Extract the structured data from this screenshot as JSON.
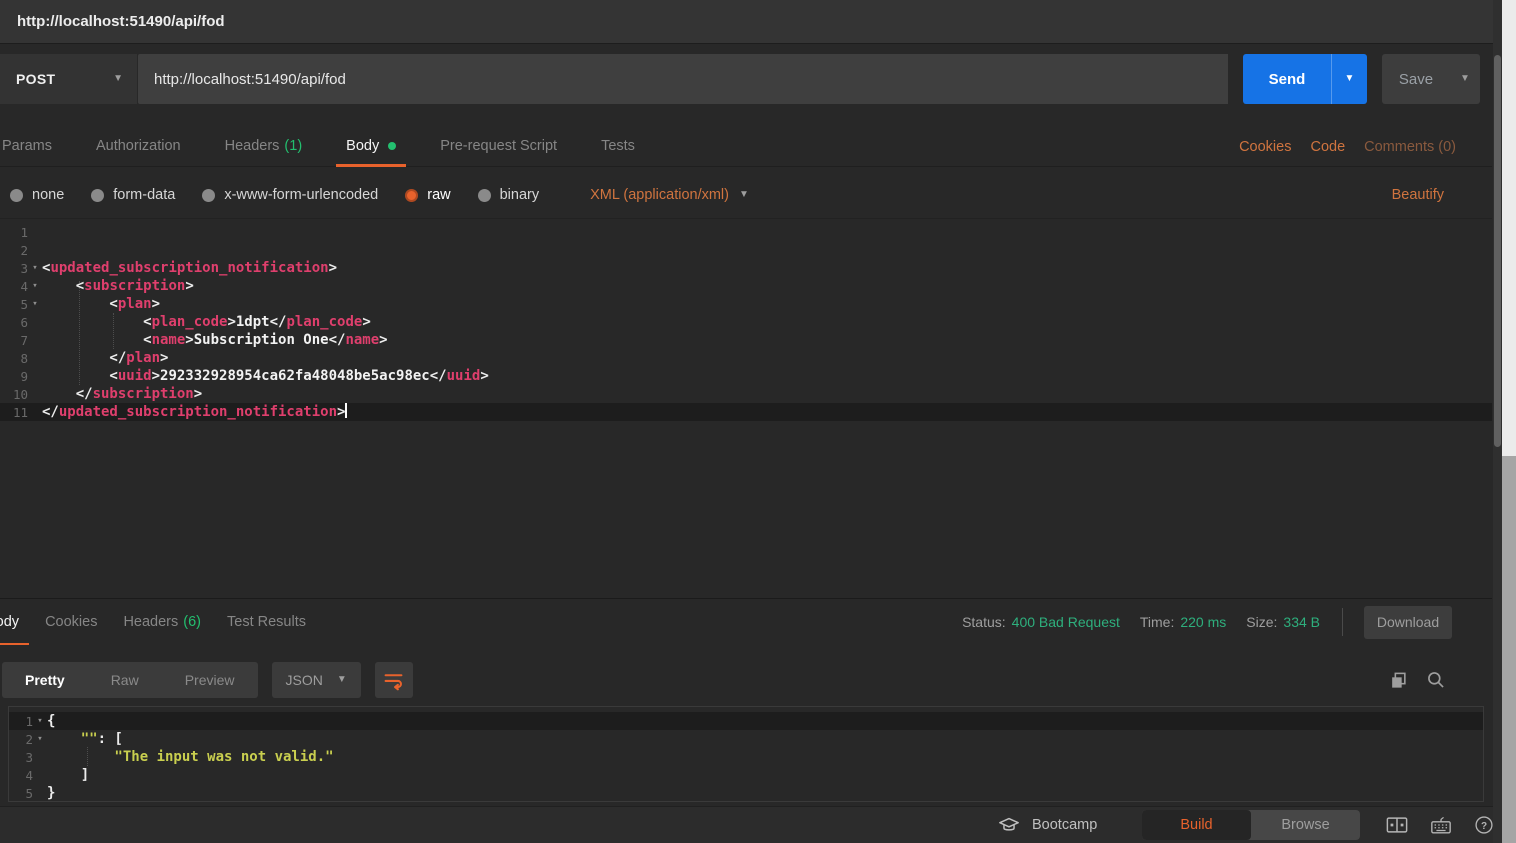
{
  "colors": {
    "accent_orange": "#e8622c",
    "link_orange": "#d0743f",
    "green": "#23bf6f",
    "status_green": "#2eaf7d",
    "blue": "#1673e6",
    "code_pink": "#df3f6d",
    "code_yellow": "#c9cf4f"
  },
  "titlebar": {
    "title": "http://localhost:51490/api/fod"
  },
  "request_bar": {
    "method": "POST",
    "url": "http://localhost:51490/api/fod",
    "send_label": "Send",
    "save_label": "Save"
  },
  "request_tabs": {
    "items": [
      {
        "label": "Params"
      },
      {
        "label": "Authorization"
      },
      {
        "label": "Headers",
        "count": "(1)"
      },
      {
        "label": "Body",
        "active": true,
        "dot": true
      },
      {
        "label": "Pre-request Script"
      },
      {
        "label": "Tests"
      }
    ],
    "links": [
      {
        "label": "Cookies"
      },
      {
        "label": "Code"
      },
      {
        "label": "Comments (0)",
        "muted": true
      }
    ]
  },
  "body_type_row": {
    "options": [
      {
        "label": "none"
      },
      {
        "label": "form-data"
      },
      {
        "label": "x-www-form-urlencoded"
      },
      {
        "label": "raw",
        "selected": true
      },
      {
        "label": "binary"
      }
    ],
    "content_type": "XML (application/xml)",
    "beautify_label": "Beautify"
  },
  "request_editor": {
    "lines": [
      {
        "n": 1,
        "segs": []
      },
      {
        "n": 2,
        "segs": []
      },
      {
        "n": 3,
        "fold": true,
        "segs": [
          [
            "p",
            "<"
          ],
          [
            "t",
            "updated_subscription_notification"
          ],
          [
            "p",
            ">"
          ]
        ]
      },
      {
        "n": 4,
        "fold": true,
        "segs": [
          [
            "p",
            "    <"
          ],
          [
            "t",
            "subscription"
          ],
          [
            "p",
            ">"
          ]
        ]
      },
      {
        "n": 5,
        "fold": true,
        "segs": [
          [
            "p",
            "        <"
          ],
          [
            "t",
            "plan"
          ],
          [
            "p",
            ">"
          ]
        ]
      },
      {
        "n": 6,
        "segs": [
          [
            "p",
            "            <"
          ],
          [
            "t",
            "plan_code"
          ],
          [
            "p",
            ">"
          ],
          [
            "v",
            "1dpt"
          ],
          [
            "p",
            "</"
          ],
          [
            "t",
            "plan_code"
          ],
          [
            "p",
            ">"
          ]
        ]
      },
      {
        "n": 7,
        "segs": [
          [
            "p",
            "            <"
          ],
          [
            "t",
            "name"
          ],
          [
            "p",
            ">"
          ],
          [
            "v",
            "Subscription One"
          ],
          [
            "p",
            "</"
          ],
          [
            "t",
            "name"
          ],
          [
            "p",
            ">"
          ]
        ]
      },
      {
        "n": 8,
        "segs": [
          [
            "p",
            "        </"
          ],
          [
            "t",
            "plan"
          ],
          [
            "p",
            ">"
          ]
        ]
      },
      {
        "n": 9,
        "segs": [
          [
            "p",
            "        <"
          ],
          [
            "t",
            "uuid"
          ],
          [
            "p",
            ">"
          ],
          [
            "v",
            "292332928954ca62fa48048be5ac98ec"
          ],
          [
            "p",
            "</"
          ],
          [
            "t",
            "uuid"
          ],
          [
            "p",
            ">"
          ]
        ]
      },
      {
        "n": 10,
        "segs": [
          [
            "p",
            "    </"
          ],
          [
            "t",
            "subscription"
          ],
          [
            "p",
            ">"
          ]
        ]
      },
      {
        "n": 11,
        "active": true,
        "cursor": true,
        "segs": [
          [
            "p",
            "</"
          ],
          [
            "t",
            "updated_subscription_notification"
          ],
          [
            "p",
            ">"
          ]
        ]
      }
    ]
  },
  "response_meta": {
    "tabs": [
      {
        "label": "Body",
        "active": true
      },
      {
        "label": "Cookies"
      },
      {
        "label": "Headers",
        "count": "(6)"
      },
      {
        "label": "Test Results"
      }
    ],
    "status_label": "Status:",
    "status_value": "400 Bad Request",
    "time_label": "Time:",
    "time_value": "220 ms",
    "size_label": "Size:",
    "size_value": "334 B",
    "download_label": "Download"
  },
  "response_toolbar": {
    "views": [
      {
        "label": "Pretty",
        "active": true
      },
      {
        "label": "Raw"
      },
      {
        "label": "Preview"
      }
    ],
    "format": "JSON"
  },
  "response_editor": {
    "lines": [
      {
        "n": 1,
        "fold": true,
        "active": true,
        "segs": [
          [
            "p",
            "{"
          ]
        ]
      },
      {
        "n": 2,
        "fold": true,
        "segs": [
          [
            "p",
            "    "
          ],
          [
            "k",
            "\"\""
          ],
          [
            "p",
            ": ["
          ]
        ]
      },
      {
        "n": 3,
        "segs": [
          [
            "s",
            "        \"The input was not valid.\""
          ]
        ]
      },
      {
        "n": 4,
        "segs": [
          [
            "p",
            "    ]"
          ]
        ]
      },
      {
        "n": 5,
        "segs": [
          [
            "p",
            "}"
          ]
        ]
      }
    ]
  },
  "bottombar": {
    "bootcamp_label": "Bootcamp",
    "build_label": "Build",
    "browse_label": "Browse"
  }
}
